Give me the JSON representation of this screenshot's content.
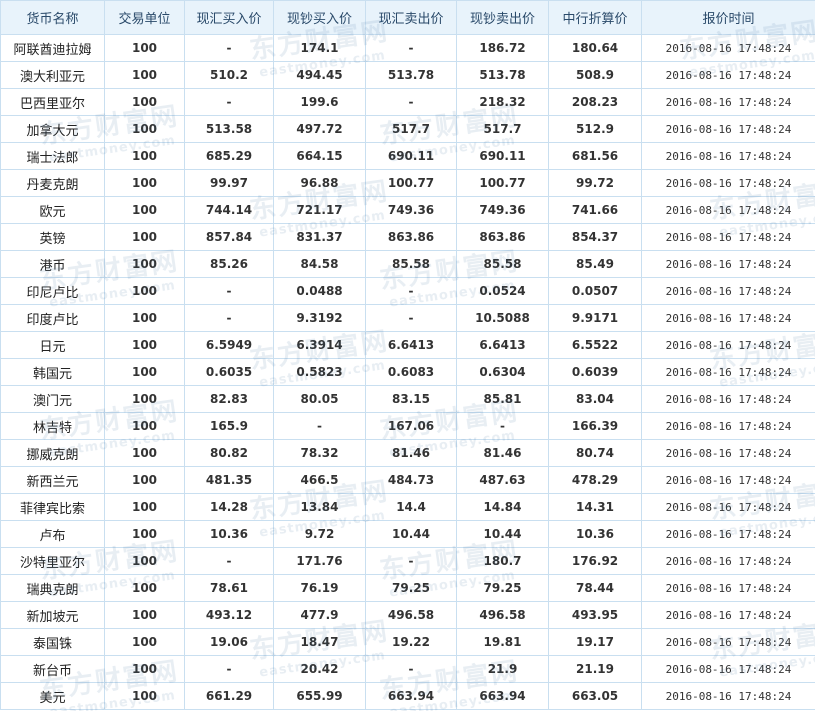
{
  "table": {
    "headers": [
      "货币名称",
      "交易单位",
      "现汇买入价",
      "现钞买入价",
      "现汇卖出价",
      "现钞卖出价",
      "中行折算价",
      "报价时间"
    ],
    "rows": [
      [
        "阿联酋迪拉姆",
        "100",
        "-",
        "174.1",
        "-",
        "186.72",
        "180.64",
        "2016-08-16 17:48:24"
      ],
      [
        "澳大利亚元",
        "100",
        "510.2",
        "494.45",
        "513.78",
        "513.78",
        "508.9",
        "2016-08-16 17:48:24"
      ],
      [
        "巴西里亚尔",
        "100",
        "-",
        "199.6",
        "-",
        "218.32",
        "208.23",
        "2016-08-16 17:48:24"
      ],
      [
        "加拿大元",
        "100",
        "513.58",
        "497.72",
        "517.7",
        "517.7",
        "512.9",
        "2016-08-16 17:48:24"
      ],
      [
        "瑞士法郎",
        "100",
        "685.29",
        "664.15",
        "690.11",
        "690.11",
        "681.56",
        "2016-08-16 17:48:24"
      ],
      [
        "丹麦克朗",
        "100",
        "99.97",
        "96.88",
        "100.77",
        "100.77",
        "99.72",
        "2016-08-16 17:48:24"
      ],
      [
        "欧元",
        "100",
        "744.14",
        "721.17",
        "749.36",
        "749.36",
        "741.66",
        "2016-08-16 17:48:24"
      ],
      [
        "英镑",
        "100",
        "857.84",
        "831.37",
        "863.86",
        "863.86",
        "854.37",
        "2016-08-16 17:48:24"
      ],
      [
        "港币",
        "100",
        "85.26",
        "84.58",
        "85.58",
        "85.58",
        "85.49",
        "2016-08-16 17:48:24"
      ],
      [
        "印尼卢比",
        "100",
        "-",
        "0.0488",
        "-",
        "0.0524",
        "0.0507",
        "2016-08-16 17:48:24"
      ],
      [
        "印度卢比",
        "100",
        "-",
        "9.3192",
        "-",
        "10.5088",
        "9.9171",
        "2016-08-16 17:48:24"
      ],
      [
        "日元",
        "100",
        "6.5949",
        "6.3914",
        "6.6413",
        "6.6413",
        "6.5522",
        "2016-08-16 17:48:24"
      ],
      [
        "韩国元",
        "100",
        "0.6035",
        "0.5823",
        "0.6083",
        "0.6304",
        "0.6039",
        "2016-08-16 17:48:24"
      ],
      [
        "澳门元",
        "100",
        "82.83",
        "80.05",
        "83.15",
        "85.81",
        "83.04",
        "2016-08-16 17:48:24"
      ],
      [
        "林吉特",
        "100",
        "165.9",
        "-",
        "167.06",
        "-",
        "166.39",
        "2016-08-16 17:48:24"
      ],
      [
        "挪威克朗",
        "100",
        "80.82",
        "78.32",
        "81.46",
        "81.46",
        "80.74",
        "2016-08-16 17:48:24"
      ],
      [
        "新西兰元",
        "100",
        "481.35",
        "466.5",
        "484.73",
        "487.63",
        "478.29",
        "2016-08-16 17:48:24"
      ],
      [
        "菲律宾比索",
        "100",
        "14.28",
        "13.84",
        "14.4",
        "14.84",
        "14.31",
        "2016-08-16 17:48:24"
      ],
      [
        "卢布",
        "100",
        "10.36",
        "9.72",
        "10.44",
        "10.44",
        "10.36",
        "2016-08-16 17:48:24"
      ],
      [
        "沙特里亚尔",
        "100",
        "-",
        "171.76",
        "-",
        "180.7",
        "176.92",
        "2016-08-16 17:48:24"
      ],
      [
        "瑞典克朗",
        "100",
        "78.61",
        "76.19",
        "79.25",
        "79.25",
        "78.44",
        "2016-08-16 17:48:24"
      ],
      [
        "新加坡元",
        "100",
        "493.12",
        "477.9",
        "496.58",
        "496.58",
        "493.95",
        "2016-08-16 17:48:24"
      ],
      [
        "泰国铢",
        "100",
        "19.06",
        "18.47",
        "19.22",
        "19.81",
        "19.17",
        "2016-08-16 17:48:24"
      ],
      [
        "新台币",
        "100",
        "-",
        "20.42",
        "-",
        "21.9",
        "21.19",
        "2016-08-16 17:48:24"
      ],
      [
        "美元",
        "100",
        "661.29",
        "655.99",
        "663.94",
        "663.94",
        "663.05",
        "2016-08-16 17:48:24"
      ]
    ]
  },
  "watermark": {
    "name": "东方财富网",
    "domain": "eastmoney.com"
  },
  "colors": {
    "border": "#c9dff0",
    "header_bg": "#e8f3fb",
    "header_text": "#2a4a6a",
    "body_text": "#333333"
  }
}
